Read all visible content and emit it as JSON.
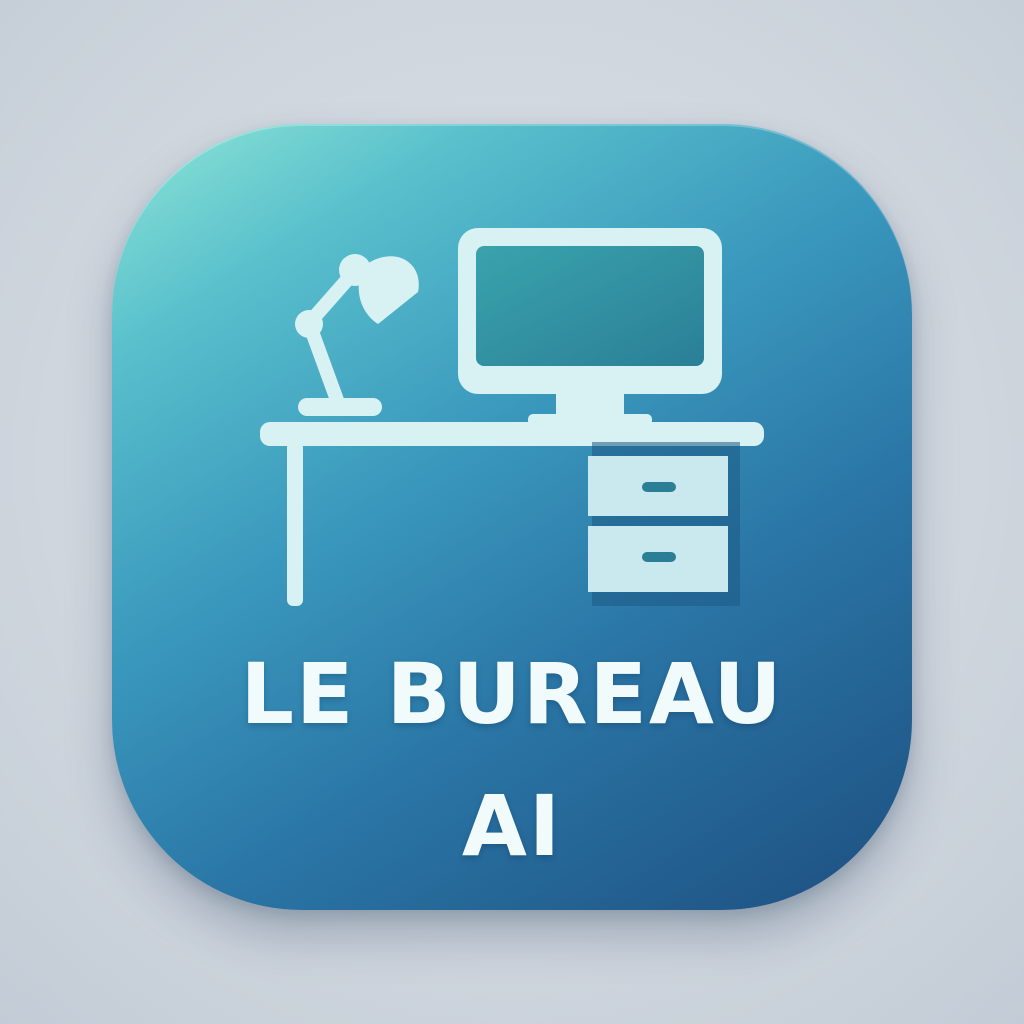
{
  "app": {
    "title_line_1": "LE BUREAU",
    "title_line_2": "AI"
  },
  "icons": {
    "desk": "desk-icon",
    "lamp": "desk-lamp-icon",
    "monitor": "monitor-icon",
    "drawers": "drawer-cabinet-icon"
  },
  "colors": {
    "gradient_top_left": "#8fe6d6",
    "gradient_mid": "#3a98bd",
    "gradient_bottom_right": "#1d4f80",
    "illustration_fill": "#d8f2f4",
    "text": "#f2fbfc"
  }
}
